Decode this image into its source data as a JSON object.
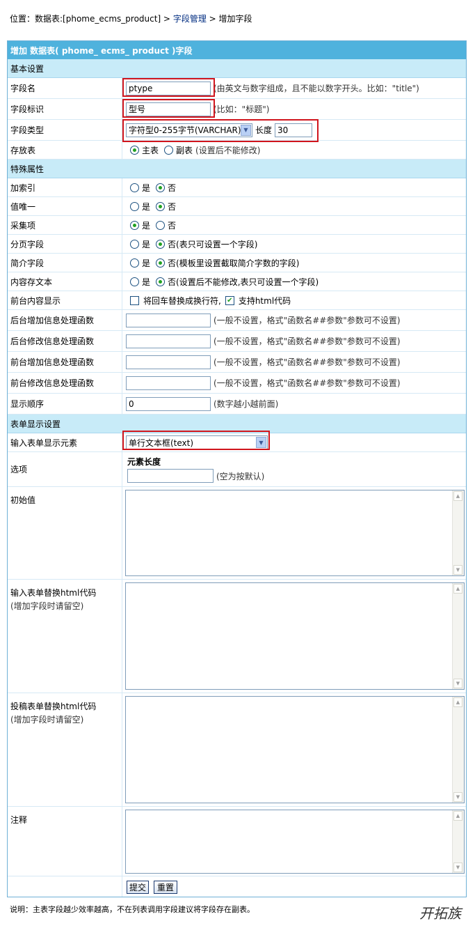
{
  "breadcrumb": {
    "prefix": "位置：数据表:[phome_ecms_product] > ",
    "link_fields": "字段管理",
    "sep": " > ",
    "current": "增加字段"
  },
  "form": {
    "title": "增加 数据表( phome_ ecms_ product )字段",
    "sections": {
      "basic": "基本设置",
      "special": "特殊属性",
      "display": "表单显示设置"
    },
    "field_name": {
      "label": "字段名",
      "value": "ptype",
      "hint": "(由英文与数字组成，且不能以数字开头。比如：\"title\")"
    },
    "field_title": {
      "label": "字段标识",
      "value": "型号",
      "hint": "(比如：\"标题\")"
    },
    "field_type": {
      "label": "字段类型",
      "selected": "字符型0-255字节(VARCHAR)",
      "length_label": "长度",
      "length_value": "30"
    },
    "store_table": {
      "label": "存放表",
      "opt_main": "主表",
      "opt_sub": "副表",
      "hint": "(设置后不能修改)"
    },
    "yes": "是",
    "no": "否",
    "add_index": {
      "label": "加索引"
    },
    "unique": {
      "label": "值唯一"
    },
    "collect": {
      "label": "采集项"
    },
    "page_field": {
      "label": "分页字段",
      "hint": "(表只可设置一个字段)"
    },
    "intro_field": {
      "label": "简介字段",
      "hint": "(模板里设置截取简介字数的字段)"
    },
    "content_file": {
      "label": "内容存文本",
      "hint": "(设置后不能修改,表只可设置一个字段)"
    },
    "front_display": {
      "label": "前台内容显示",
      "opt1": "将回车替换成换行符,",
      "opt2": "支持html代码"
    },
    "func_hint": "(一般不设置，格式\"函数名##参数\"参数可不设置)",
    "back_add_func": {
      "label": "后台增加信息处理函数"
    },
    "back_edit_func": {
      "label": "后台修改信息处理函数"
    },
    "front_add_func": {
      "label": "前台增加信息处理函数"
    },
    "front_edit_func": {
      "label": "前台修改信息处理函数"
    },
    "order": {
      "label": "显示顺序",
      "value": "0",
      "hint": "(数字越小越前面)"
    },
    "input_element": {
      "label": "输入表单显示元素",
      "selected": "单行文本框(text)"
    },
    "options": {
      "label": "选项",
      "elem_len_label": "元素长度",
      "hint": "(空为按默认)"
    },
    "init_value": {
      "label": "初始值"
    },
    "input_html": {
      "label": "输入表单替换html代码",
      "sub": "(增加字段时请留空)"
    },
    "submit_html": {
      "label": "投稿表单替换html代码",
      "sub": "(增加字段时请留空)"
    },
    "comment": {
      "label": "注释"
    },
    "buttons": {
      "submit": "提交",
      "reset": "重置"
    }
  },
  "note": "说明：主表字段越少效率越高，不在列表调用字段建议将字段存在副表。",
  "watermark": "开拓族",
  "colors": {
    "title_bar": "#4fb2dd",
    "section_bg": "#c8ebf8",
    "highlight": "#d0151d"
  }
}
